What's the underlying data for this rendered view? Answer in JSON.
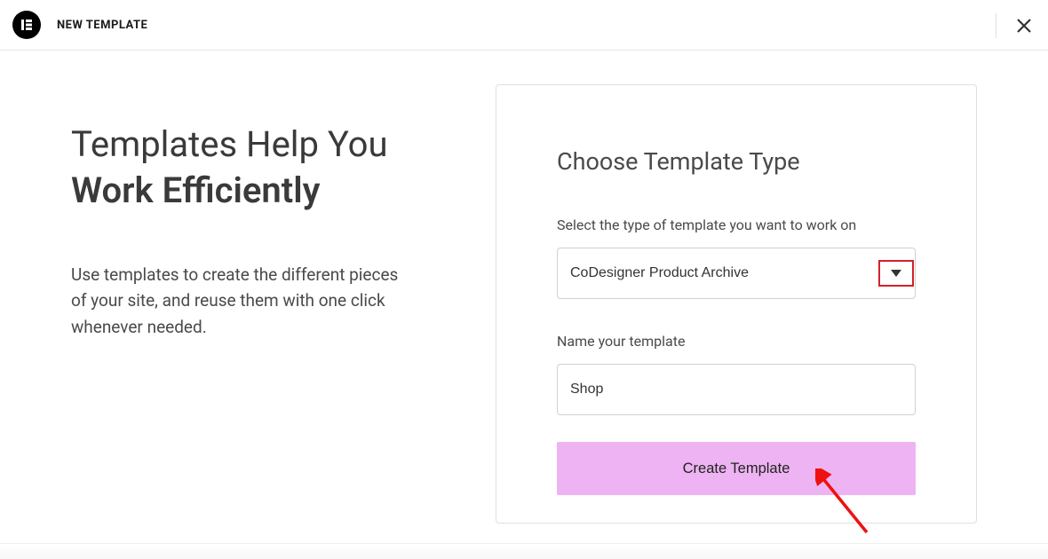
{
  "header": {
    "title": "NEW TEMPLATE"
  },
  "left": {
    "heading_line1": "Templates Help You",
    "heading_line2": "Work Efficiently",
    "description": "Use templates to create the different pieces of your site, and reuse them with one click whenever needed."
  },
  "panel": {
    "title": "Choose Template Type",
    "type_label": "Select the type of template you want to work on",
    "type_value": "CoDesigner Product Archive",
    "name_label": "Name your template",
    "name_value": "Shop",
    "submit_label": "Create Template"
  },
  "annotation": {
    "highlight": "dropdown-chevron"
  }
}
